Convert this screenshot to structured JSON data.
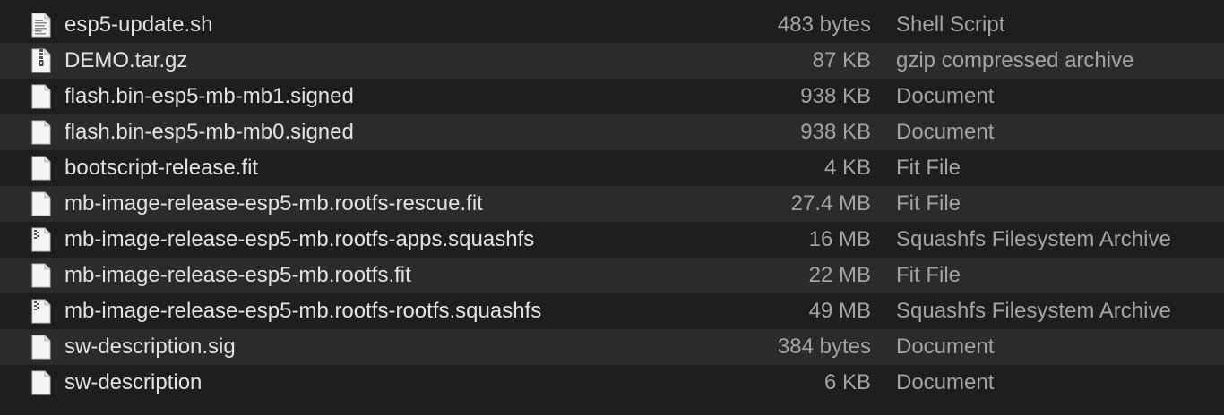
{
  "files": [
    {
      "name": "esp5-update.sh",
      "size": "483 bytes",
      "kind": "Shell Script",
      "icon": "script-file-icon"
    },
    {
      "name": "DEMO.tar.gz",
      "size": "87 KB",
      "kind": "gzip compressed archive",
      "icon": "archive-file-icon"
    },
    {
      "name": "flash.bin-esp5-mb-mb1.signed",
      "size": "938 KB",
      "kind": "Document",
      "icon": "document-file-icon"
    },
    {
      "name": "flash.bin-esp5-mb-mb0.signed",
      "size": "938 KB",
      "kind": "Document",
      "icon": "document-file-icon"
    },
    {
      "name": "bootscript-release.fit",
      "size": "4 KB",
      "kind": "Fit File",
      "icon": "document-file-icon"
    },
    {
      "name": "mb-image-release-esp5-mb.rootfs-rescue.fit",
      "size": "27.4 MB",
      "kind": "Fit File",
      "icon": "document-file-icon"
    },
    {
      "name": "mb-image-release-esp5-mb.rootfs-apps.squashfs",
      "size": "16 MB",
      "kind": "Squashfs Filesystem Archive",
      "icon": "squashfs-archive-icon"
    },
    {
      "name": "mb-image-release-esp5-mb.rootfs.fit",
      "size": "22 MB",
      "kind": "Fit File",
      "icon": "document-file-icon"
    },
    {
      "name": "mb-image-release-esp5-mb.rootfs-rootfs.squashfs",
      "size": "49 MB",
      "kind": "Squashfs Filesystem Archive",
      "icon": "squashfs-archive-icon"
    },
    {
      "name": "sw-description.sig",
      "size": "384 bytes",
      "kind": "Document",
      "icon": "document-file-icon"
    },
    {
      "name": "sw-description",
      "size": "6 KB",
      "kind": "Document",
      "icon": "document-file-icon"
    }
  ]
}
